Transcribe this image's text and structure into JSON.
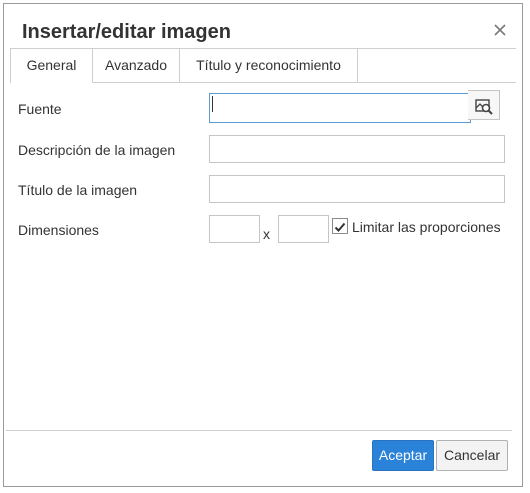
{
  "dialog": {
    "title": "Insertar/editar imagen"
  },
  "tabs": [
    {
      "label": "General"
    },
    {
      "label": "Avanzado"
    },
    {
      "label": "Título y reconocimiento"
    }
  ],
  "form": {
    "source_label": "Fuente",
    "source_value": "",
    "description_label": "Descripción de la imagen",
    "description_value": "",
    "title_label": "Título de la imagen",
    "title_value": "",
    "dimensions_label": "Dimensiones",
    "width_value": "",
    "height_value": "",
    "dimension_separator": "x",
    "constrain_label": "Limitar las proporciones",
    "constrain_checked": true
  },
  "buttons": {
    "ok_label": "Aceptar",
    "cancel_label": "Cancelar"
  },
  "icons": {
    "close": "close-icon",
    "browse": "image-search-icon",
    "check": "checkmark-icon"
  },
  "colors": {
    "primary_button": "#2b82d9",
    "focus_border": "#5b9bd5"
  }
}
